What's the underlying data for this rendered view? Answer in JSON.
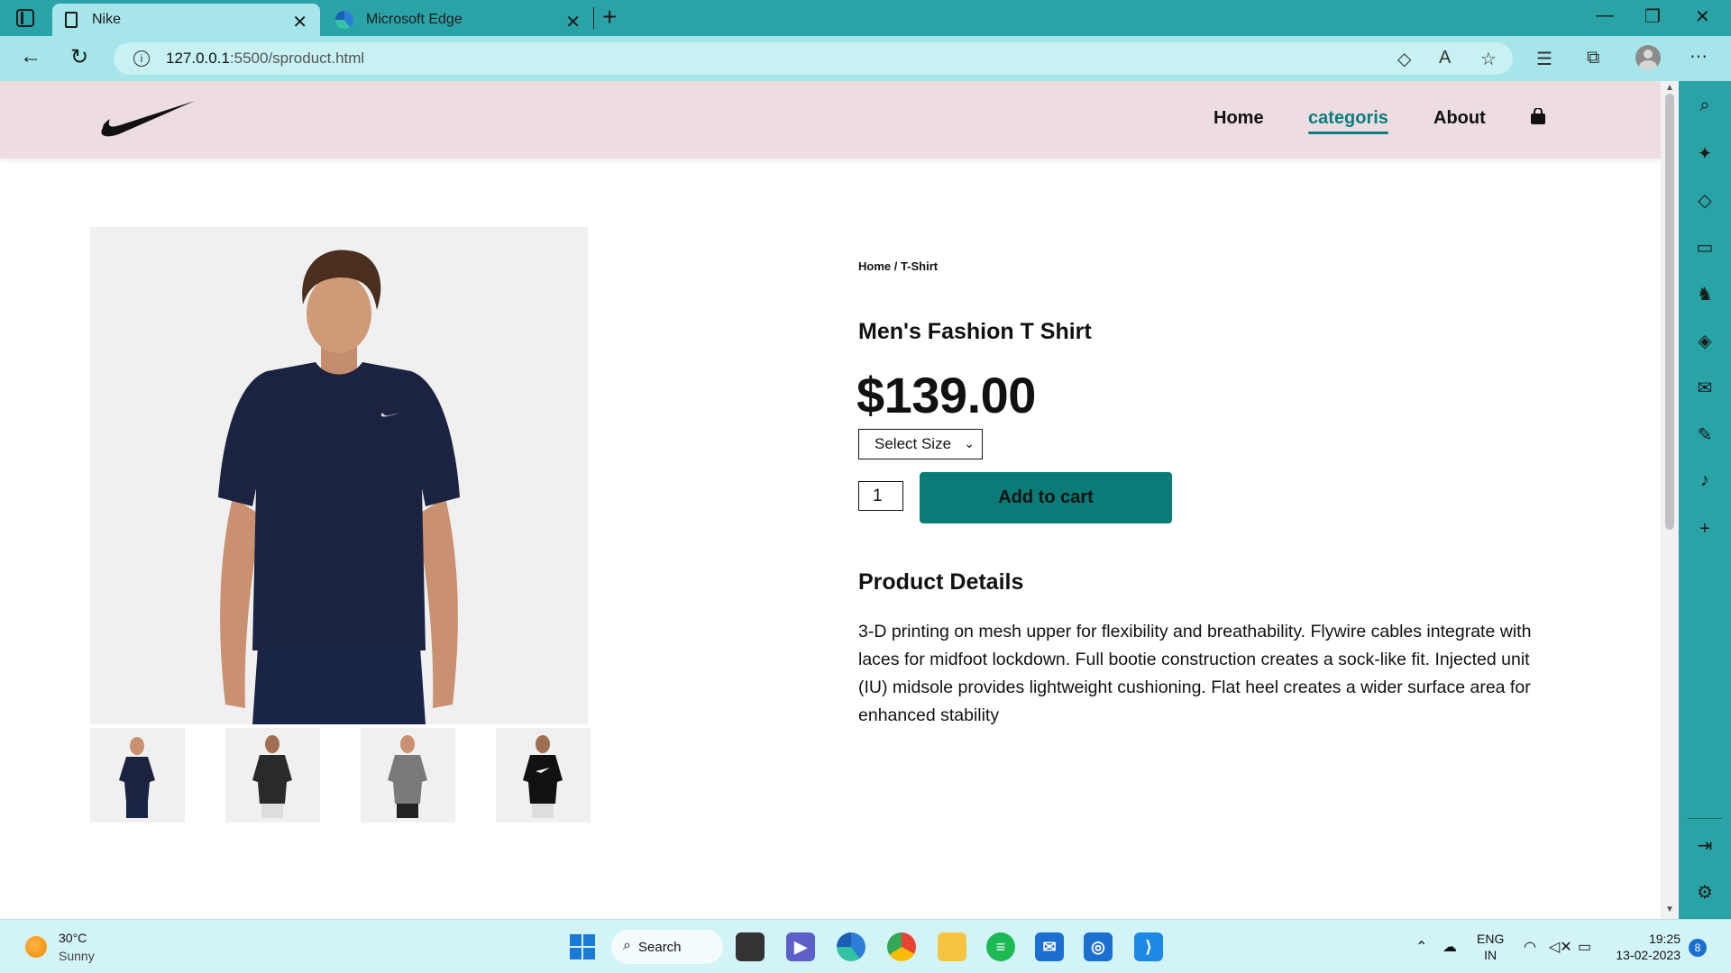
{
  "browser": {
    "tabs": [
      {
        "label": "Nike",
        "icon": "document-icon",
        "active": true
      },
      {
        "label": "Microsoft Edge",
        "icon": "edge-logo-icon",
        "active": false
      }
    ],
    "url_host": "127.0.0.1",
    "url_path": ":5500/sproduct.html"
  },
  "site": {
    "nav": [
      {
        "label": "Home",
        "active": false
      },
      {
        "label": "categoris",
        "active": true
      },
      {
        "label": "About",
        "active": false
      }
    ],
    "accent_color": "#0a7c78",
    "header_bg": "#eddde0"
  },
  "product": {
    "breadcrumb": "Home / T-Shirt",
    "title": "Men's Fashion T Shirt",
    "price": "$139.00",
    "size_select": "Select Size",
    "quantity": "1",
    "add_to_cart": "Add to cart",
    "details_heading": "Product Details",
    "details_text": "3-D printing on mesh upper for flexibility and breathability. Flywire cables integrate with laces for midfoot lockdown. Full bootie construction creates a sock-like fit. Injected unit (IU) midsole provides lightweight cushioning. Flat heel creates a wider surface area for enhanced stability"
  },
  "taskbar": {
    "weather_temp": "30°C",
    "weather_desc": "Sunny",
    "search_label": "Search",
    "lang_line1": "ENG",
    "lang_line2": "IN",
    "time": "19:25",
    "date": "13-02-2023",
    "notification_count": "8"
  }
}
